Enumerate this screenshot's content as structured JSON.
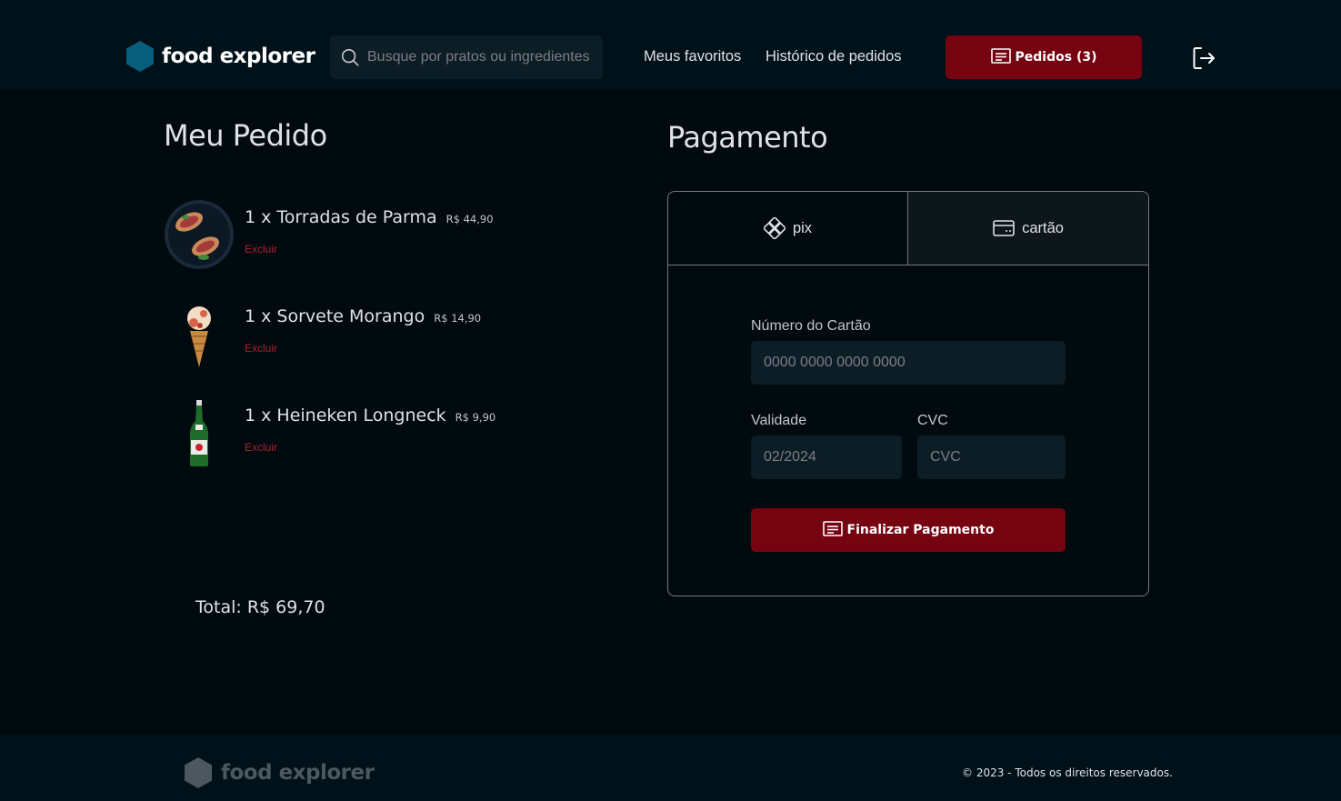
{
  "header": {
    "brand": "food explorer",
    "search_placeholder": "Busque por pratos ou ingredientes",
    "nav": {
      "favorites": "Meus favoritos",
      "history": "Histórico de pedidos"
    },
    "orders_button": "Pedidos (3)",
    "colors": {
      "accent": "#750310",
      "brand_icon": "#065e7c"
    }
  },
  "order": {
    "title": "Meu Pedido",
    "items": [
      {
        "name": "1 x Torradas de Parma",
        "price": "R$ 44,90",
        "remove": "Excluir"
      },
      {
        "name": "1 x Sorvete Morango",
        "price": "R$ 14,90",
        "remove": "Excluir"
      },
      {
        "name": "1 x Heineken Longneck",
        "price": "R$ 9,90",
        "remove": "Excluir"
      }
    ],
    "total": "Total: R$ 69,70"
  },
  "payment": {
    "title": "Pagamento",
    "tabs": {
      "pix": "pix",
      "card": "cartão"
    },
    "card_number_label": "Número do Cartão",
    "card_number_placeholder": "0000 0000 0000 0000",
    "expiry_label": "Validade",
    "expiry_placeholder": "02/2024",
    "cvc_label": "CVC",
    "cvc_placeholder": "CVC",
    "submit": "Finalizar Pagamento"
  },
  "footer": {
    "brand": "food explorer",
    "copyright": "© 2023 - Todos os direitos reservados."
  }
}
